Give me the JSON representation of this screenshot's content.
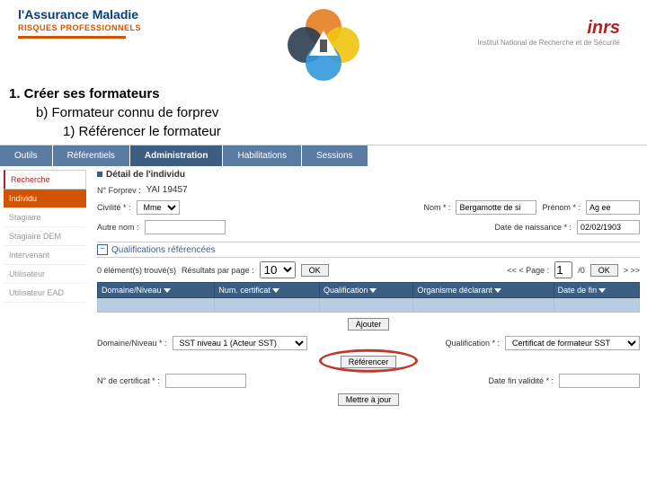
{
  "logos": {
    "assurance_maladie": "l'Assurance Maladie",
    "assurance_sub": "RISQUES PROFESSIONNELS",
    "inrs": "inrs",
    "inrs_sub": "Institut National de Recherche et de Sécurité"
  },
  "slide": {
    "line1": "1.  Créer ses formateurs",
    "line2": "b)  Formateur connu de forprev",
    "line3": "1)  Référencer le formateur"
  },
  "topnav": {
    "outils": "Outils",
    "referentiels": "Référentiels",
    "administration": "Administration",
    "habilitations": "Habilitations",
    "sessions": "Sessions"
  },
  "sidebar": {
    "recherche": "Recherche",
    "individu": "Individu",
    "stagiaire": "Stagiaire",
    "stagiaire_dem": "Stagiaire DEM",
    "intervenant": "Intervenant",
    "utilisateur": "Utilisateur",
    "utilisateur_ead": "Utilisateur EAD"
  },
  "detail": {
    "panel_title": "Détail de l'individu",
    "num_forprev_label": "N° Forprev  :",
    "num_forprev_value": "YAI 19457",
    "civilite_label": "Civilité * :",
    "civilite_value": "Mme",
    "nom_label": "Nom * :",
    "nom_value": "Bergamotte de si",
    "prenom_label": "Prénom * :",
    "prenom_value": "Ag ee",
    "autre_nom_label": "Autre nom :",
    "autre_nom_value": "",
    "date_naissance_label": "Date de naissance * :",
    "date_naissance_value": "02/02/1903"
  },
  "qualifications": {
    "section_title": "Qualifications référencées",
    "found": "0 élément(s) trouvé(s)",
    "results_per_page_label": "Résultats par page :",
    "results_per_page_value": "10",
    "ok": "OK",
    "page_prefix": "<< < Page :",
    "page_current": "1",
    "page_total": "/0",
    "page_suffix": "> >>",
    "headers": {
      "domaine_niveau": "Domaine/Niveau",
      "num_certificat": "Num. certificat",
      "qualification": "Qualification",
      "organisme": "Organisme déclarant",
      "date_fin": "Date de fin"
    },
    "ajouter": "Ajouter",
    "form": {
      "domaine_label": "Domaine/Niveau * :",
      "domaine_value": "SST niveau 1 (Acteur SST)",
      "qualification_label": "Qualification * :",
      "qualification_value": "Certificat de formateur SST",
      "referencer": "Référencer",
      "num_cert_label": "N° de certificat * :",
      "num_cert_value": "",
      "date_fin_label": "Date fin validité * :",
      "date_fin_value": "",
      "mettre_a_jour": "Mettre à jour"
    }
  }
}
